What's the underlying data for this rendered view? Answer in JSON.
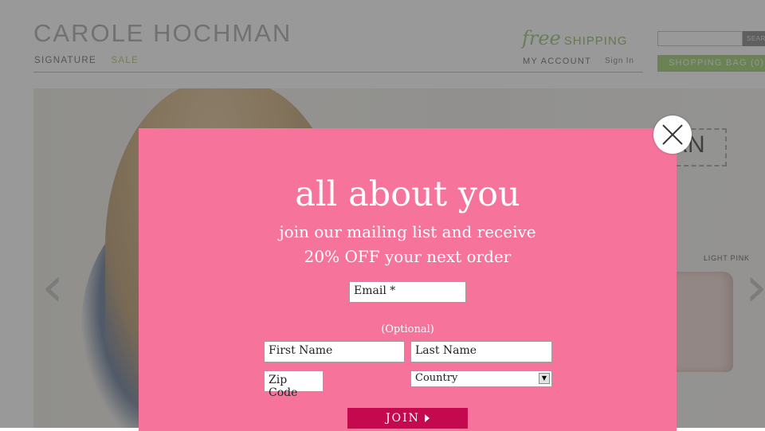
{
  "header": {
    "logo": "CAROLE HOCHMAN",
    "nav": [
      "SIGNATURE",
      "SALE"
    ],
    "free_word": "free",
    "shipping_word": "SHIPPING",
    "my_account": "MY ACCOUNT",
    "sign_in": "Sign In",
    "search_button": "SEARCH",
    "shopping_bag": "SHOPPING BAG (0)"
  },
  "hero": {
    "brand_fragment": "AN",
    "product_label": "LIGHT PINK"
  },
  "modal": {
    "title": "all about you",
    "subtitle_line1": "join our mailing list and receive",
    "subtitle_line2": "20% OFF your next order",
    "email_placeholder": "Email *",
    "optional_label": "(Optional)",
    "first_name_placeholder": "First Name",
    "last_name_placeholder": "Last Name",
    "zip_placeholder": "Zip Code",
    "country_selected": "Country",
    "join_label": "JOIN"
  },
  "colors": {
    "modal_bg": "#f6739c",
    "join_bg": "#c4094f",
    "bag_bg": "#b3d98e",
    "shipping_green": "#a9c78a"
  },
  "icons": {
    "close": "close-icon",
    "join_arrow": "play-triangle-icon",
    "slider_prev": "chevron-left-icon",
    "slider_next": "chevron-right-icon",
    "dropdown": "dropdown-arrow-icon"
  }
}
